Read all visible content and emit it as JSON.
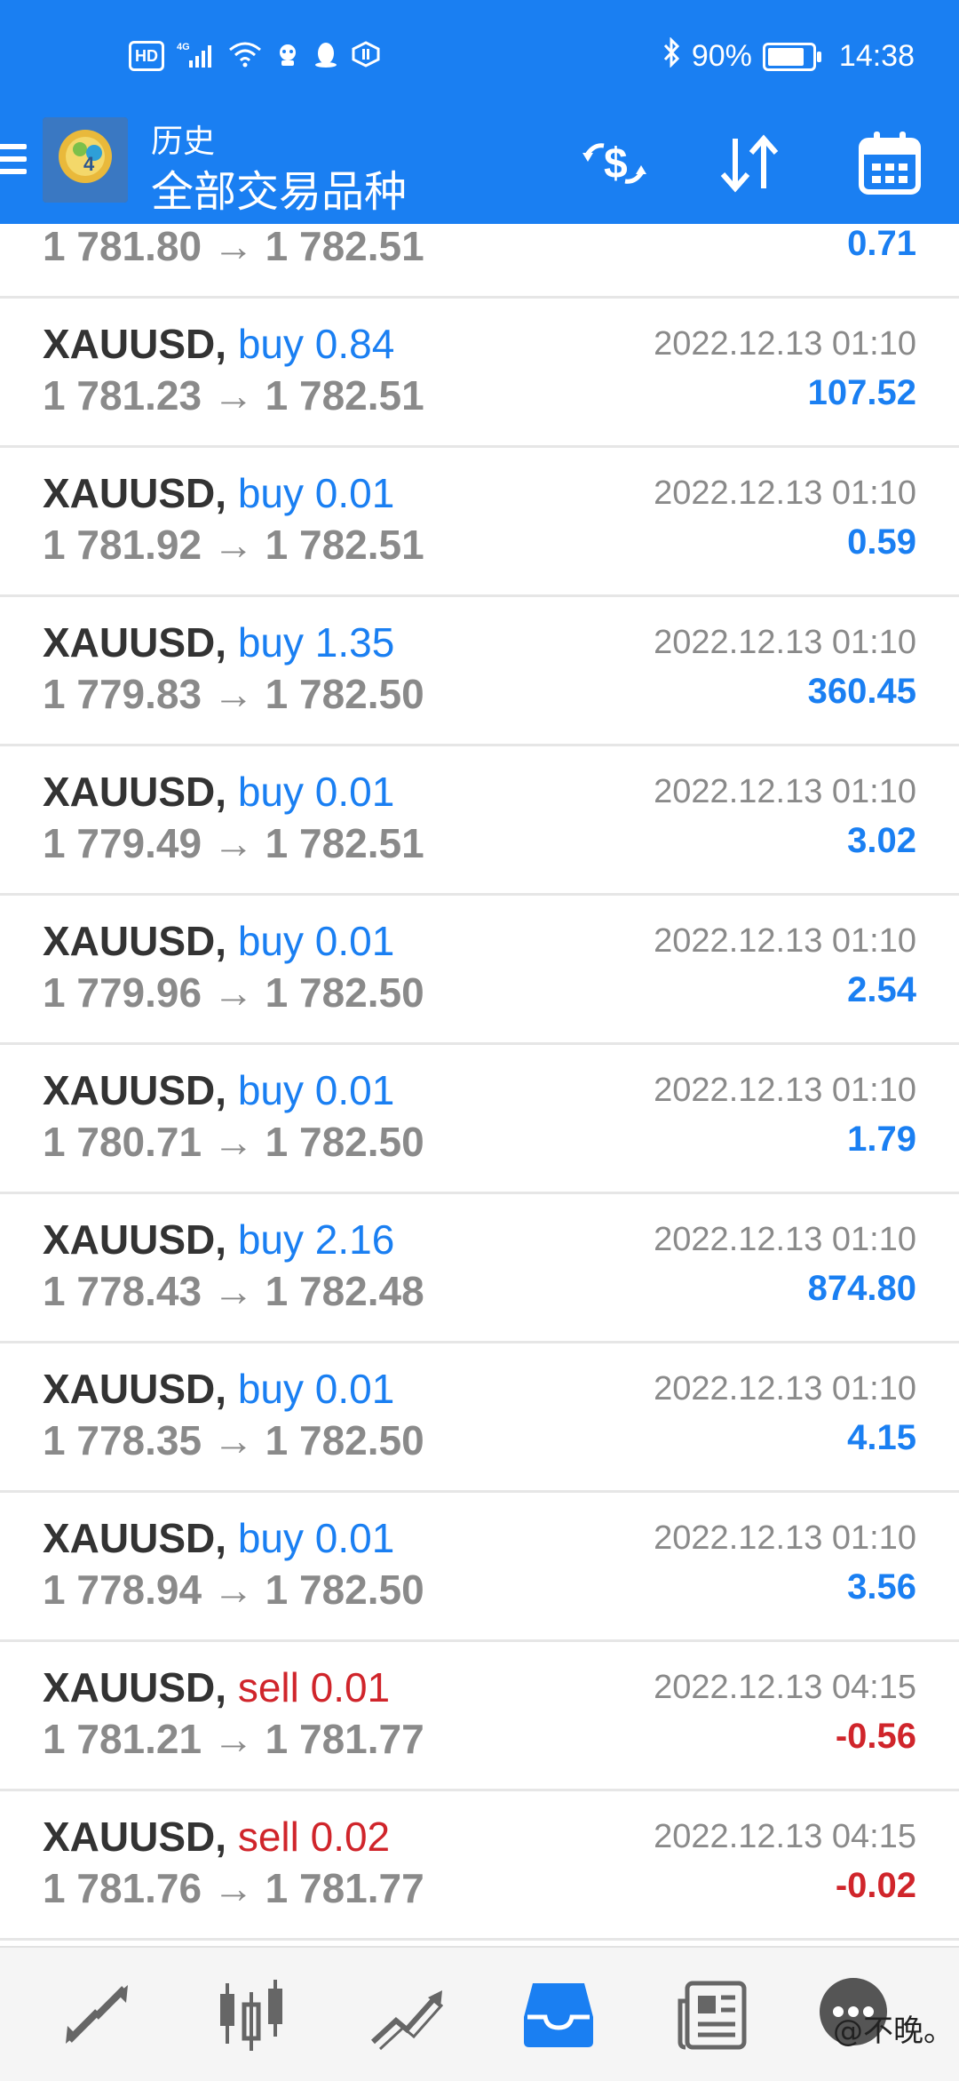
{
  "status_bar": {
    "hd": "HD",
    "net": "4G",
    "battery": "90%",
    "time": "14:38"
  },
  "header": {
    "title_small": "历史",
    "title_big": "全部交易品种"
  },
  "partial_row": {
    "prices": "1 781.80 → 1 782.51",
    "profit": "0.71"
  },
  "rows": [
    {
      "symbol": "XAUUSD,",
      "side": "buy 0.84",
      "prices": "1 781.23 → 1 782.51",
      "time": "2022.12.13 01:10",
      "profit": "107.52"
    },
    {
      "symbol": "XAUUSD,",
      "side": "buy 0.01",
      "prices": "1 781.92 → 1 782.51",
      "time": "2022.12.13 01:10",
      "profit": "0.59"
    },
    {
      "symbol": "XAUUSD,",
      "side": "buy 1.35",
      "prices": "1 779.83 → 1 782.50",
      "time": "2022.12.13 01:10",
      "profit": "360.45"
    },
    {
      "symbol": "XAUUSD,",
      "side": "buy 0.01",
      "prices": "1 779.49 → 1 782.51",
      "time": "2022.12.13 01:10",
      "profit": "3.02"
    },
    {
      "symbol": "XAUUSD,",
      "side": "buy 0.01",
      "prices": "1 779.96 → 1 782.50",
      "time": "2022.12.13 01:10",
      "profit": "2.54"
    },
    {
      "symbol": "XAUUSD,",
      "side": "buy 0.01",
      "prices": "1 780.71 → 1 782.50",
      "time": "2022.12.13 01:10",
      "profit": "1.79"
    },
    {
      "symbol": "XAUUSD,",
      "side": "buy 2.16",
      "prices": "1 778.43 → 1 782.48",
      "time": "2022.12.13 01:10",
      "profit": "874.80"
    },
    {
      "symbol": "XAUUSD,",
      "side": "buy 0.01",
      "prices": "1 778.35 → 1 782.50",
      "time": "2022.12.13 01:10",
      "profit": "4.15"
    },
    {
      "symbol": "XAUUSD,",
      "side": "buy 0.01",
      "prices": "1 778.94 → 1 782.50",
      "time": "2022.12.13 01:10",
      "profit": "3.56"
    },
    {
      "symbol": "XAUUSD,",
      "side": "sell 0.01",
      "prices": "1 781.21 → 1 781.77",
      "time": "2022.12.13 04:15",
      "profit": "-0.56"
    },
    {
      "symbol": "XAUUSD,",
      "side": "sell 0.02",
      "prices": "1 781.76 → 1 781.77",
      "time": "2022.12.13 04:15",
      "profit": "-0.02"
    }
  ],
  "nav": [
    "trade-arrows-icon",
    "candlestick-icon",
    "chart-line-icon",
    "history-inbox-icon",
    "news-icon",
    "chat-icon"
  ],
  "watermark": "@不晚。",
  "colors": {
    "accent": "#1a7ff2",
    "sell": "#d0252b",
    "muted": "#8a8a8a",
    "active_nav": "#1a7ff2"
  }
}
